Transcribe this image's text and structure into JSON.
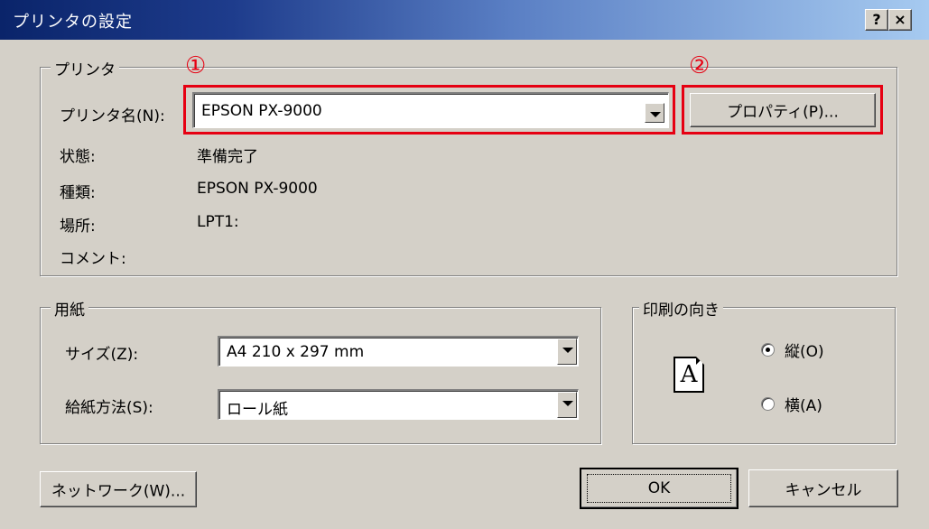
{
  "window": {
    "title": "プリンタの設定",
    "help_button": "?",
    "close_button": "×"
  },
  "printer_group": {
    "legend": "プリンタ",
    "name_label": "プリンタ名(N):",
    "name_value": "EPSON PX-9000",
    "properties_button": "プロパティ(P)...",
    "status_label": "状態:",
    "status_value": "準備完了",
    "type_label": "種類:",
    "type_value": "EPSON PX-9000",
    "location_label": "場所:",
    "location_value": "LPT1:",
    "comment_label": "コメント:"
  },
  "annotations": {
    "marker_1": "①",
    "marker_2": "②",
    "highlight_color": "#e60012"
  },
  "paper_group": {
    "legend": "用紙",
    "size_label": "サイズ(Z):",
    "size_value": "A4 210 x 297 mm",
    "source_label": "給紙方法(S):",
    "source_value": "ロール紙"
  },
  "orientation_group": {
    "legend": "印刷の向き",
    "icon_letter": "A",
    "portrait_label": "縦(O)",
    "portrait_checked": true,
    "landscape_label": "横(A)",
    "landscape_checked": false
  },
  "footer": {
    "network_button": "ネットワーク(W)...",
    "ok_button": "OK",
    "cancel_button": "キャンセル"
  }
}
